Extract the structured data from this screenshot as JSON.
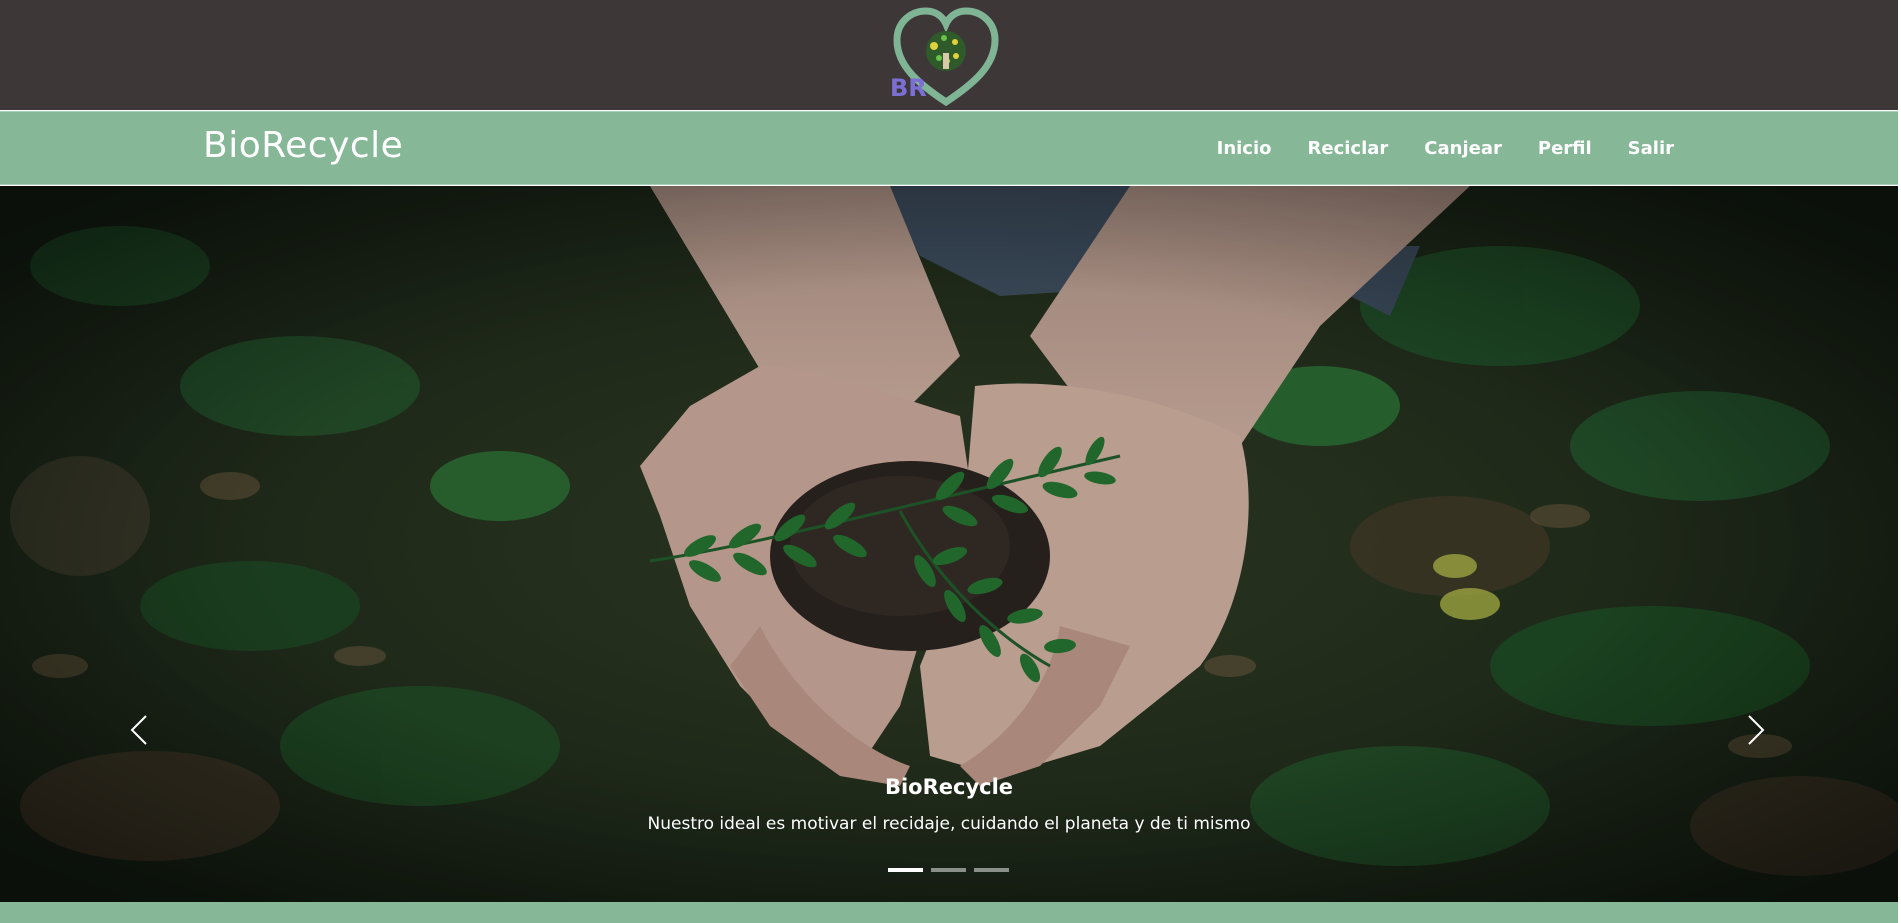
{
  "header": {
    "logo_text": "BR"
  },
  "navbar": {
    "brand": "BioRecycle",
    "items": [
      {
        "label": "Inicio"
      },
      {
        "label": "Reciclar"
      },
      {
        "label": "Canjear"
      },
      {
        "label": "Perfil"
      },
      {
        "label": "Salir"
      }
    ]
  },
  "carousel": {
    "slide_count": 3,
    "active_index": 0,
    "caption_title": "BioRecycle",
    "caption_text": "Nuestro ideal es motivar el recidaje, cuidando el planeta y de ti mismo"
  },
  "colors": {
    "topbar": "#3d3738",
    "navbar": "#86b797",
    "logo_heart": "#7fb595",
    "logo_text": "#7b6fd6"
  },
  "icons": {
    "prev": "chevron-left-icon",
    "next": "chevron-right-icon"
  }
}
